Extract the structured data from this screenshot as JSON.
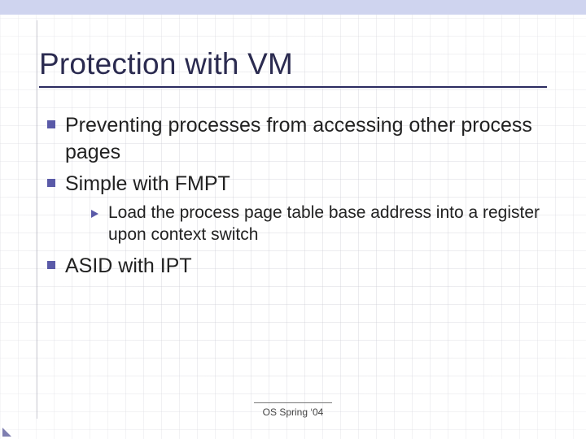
{
  "slide": {
    "title": "Protection with VM",
    "bullets": [
      {
        "level": 1,
        "text": "Preventing processes from accessing other process pages"
      },
      {
        "level": 1,
        "text": "Simple with FMPT"
      },
      {
        "level": 2,
        "text": "Load the process page table base address into a register upon context switch"
      },
      {
        "level": 1,
        "text": "ASID with IPT"
      }
    ],
    "footer": "OS Spring ‘04"
  },
  "colors": {
    "accent": "#5a5aa8",
    "topbar": "#cfd4ef",
    "rule": "#2b2b60"
  }
}
